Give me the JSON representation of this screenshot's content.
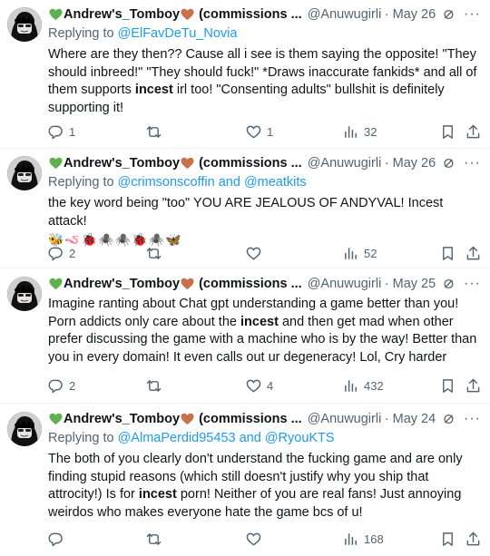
{
  "tweets": [
    {
      "author_name": "Andrew's_Tomboy",
      "author_suffix": "(commissions ...",
      "handle": "@Anuwugirlis...",
      "date": "May 26",
      "reply_prefix": "Replying to ",
      "reply_users": "@ElFavDeTu_Novia",
      "body_html": "Where are they then?? Cause all i see is them saying the opposite! \"They should inbreed!\" \"They should fuck!\" *Draws inaccurate fankids* and all of them supports <b>incest</b> irl too! \"Consenting adults\" bullshit is definitely supporting it!",
      "emojis": "",
      "replies": "1",
      "retweets": "",
      "likes": "1",
      "views": "32"
    },
    {
      "author_name": "Andrew's_Tomboy",
      "author_suffix": "(commissions ...",
      "handle": "@Anuwugirlis...",
      "date": "May 26",
      "reply_prefix": "Replying to ",
      "reply_users": "@crimsonscoffin and @meatkits",
      "body_html": "the key word being \"too\" YOU ARE JEALOUS OF ANDYVAL! Incest attack!",
      "emojis": "🐝🪱🐞🕷️🕷️🐞🕷️🦋",
      "replies": "2",
      "retweets": "",
      "likes": "",
      "views": "52"
    },
    {
      "author_name": "Andrew's_Tomboy",
      "author_suffix": "(commissions ...",
      "handle": "@Anuwugirlis...",
      "date": "May 25",
      "reply_prefix": "",
      "reply_users": "",
      "body_html": "Imagine ranting about Chat gpt understanding a game better than you! Porn addicts only care about the <b>incest</b> and then get mad when other prefer discussing the game with a machine who is by the way! Better than you in every domain! It even calls out ur degeneracy! Lol, Cry harder",
      "emojis": "",
      "replies": "2",
      "retweets": "",
      "likes": "4",
      "views": "432"
    },
    {
      "author_name": "Andrew's_Tomboy",
      "author_suffix": "(commissions ...",
      "handle": "@Anuwugirlis...",
      "date": "May 24",
      "reply_prefix": "Replying to ",
      "reply_users": "@AlmaPerdid95453 and @RyouKTS",
      "body_html": "The both of you clearly don't understand the fucking game and are only finding stupid reasons (which still doesn't justify why you ship that attrocity!) Is for <b>incest</b> porn! Neither of you are real fans! Just annoying weirdos who makes everyone hate the game bcs of u!",
      "emojis": "",
      "replies": "",
      "retweets": "",
      "likes": "",
      "views": "168"
    }
  ],
  "colors": {
    "text": "#0f1419",
    "muted": "#536471",
    "link": "#1d9bf0",
    "green_heart": "#5fb04f",
    "orange_heart": "#c9714a",
    "divider": "#eff3f4"
  },
  "icons": {
    "reply": "reply-icon",
    "retweet": "retweet-icon",
    "like": "like-icon",
    "views": "views-icon",
    "bookmark": "bookmark-icon",
    "share": "share-icon",
    "grok": "grok-icon",
    "more": "more-icon"
  }
}
